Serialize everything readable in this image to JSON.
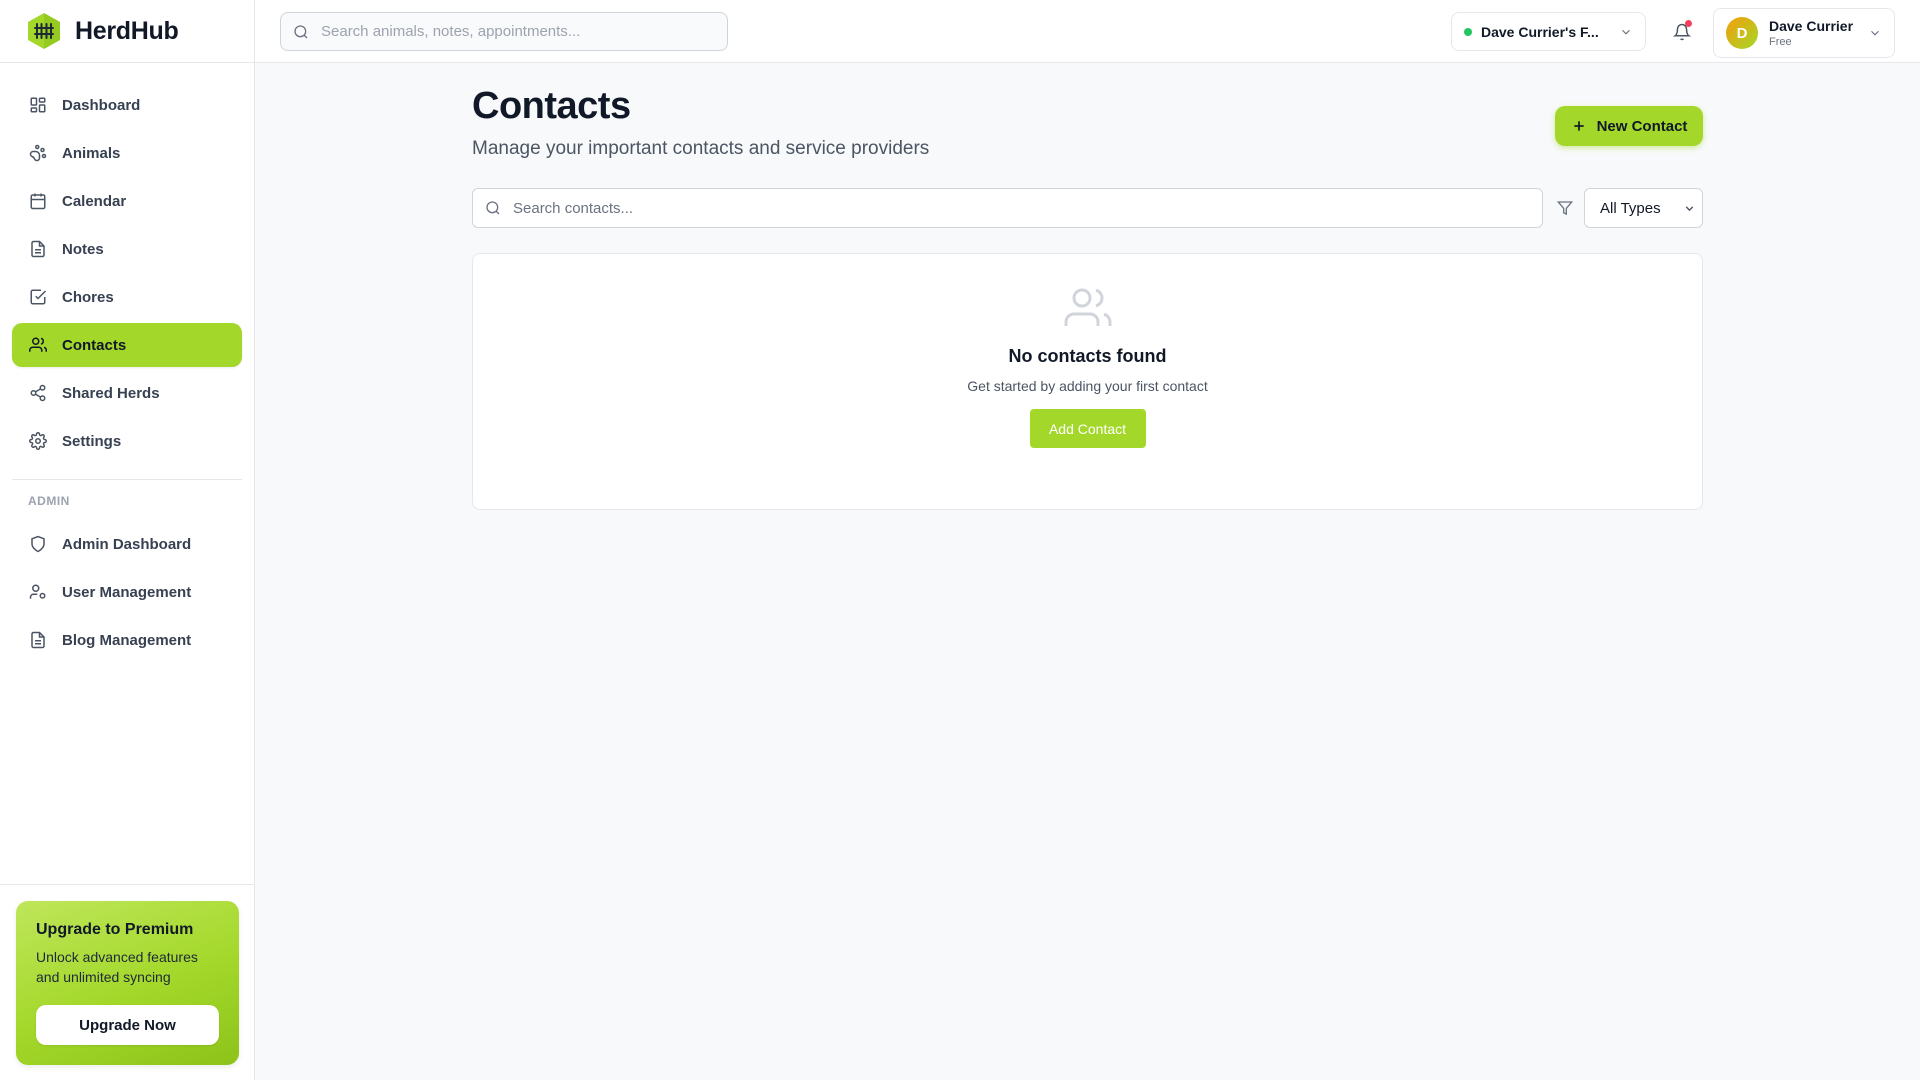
{
  "app": {
    "name": "HerdHub",
    "accent": "#a3d82a"
  },
  "header": {
    "search_placeholder": "Search animals, notes, appointments...",
    "herd_selector": "Dave Currier's F...",
    "user": {
      "name": "Dave Currier",
      "plan": "Free",
      "initial": "D"
    }
  },
  "sidebar": {
    "items": [
      {
        "label": "Dashboard",
        "icon": "dashboard-icon"
      },
      {
        "label": "Animals",
        "icon": "paw-icon"
      },
      {
        "label": "Calendar",
        "icon": "calendar-icon"
      },
      {
        "label": "Notes",
        "icon": "file-text-icon"
      },
      {
        "label": "Chores",
        "icon": "check-square-icon"
      },
      {
        "label": "Contacts",
        "icon": "users-icon",
        "active": true
      },
      {
        "label": "Shared Herds",
        "icon": "share-icon"
      },
      {
        "label": "Settings",
        "icon": "gear-icon"
      }
    ],
    "admin_heading": "ADMIN",
    "admin_items": [
      {
        "label": "Admin Dashboard",
        "icon": "shield-icon"
      },
      {
        "label": "User Management",
        "icon": "user-cog-icon"
      },
      {
        "label": "Blog Management",
        "icon": "file-text-icon"
      }
    ],
    "upgrade": {
      "title": "Upgrade to Premium",
      "description": "Unlock advanced features and unlimited syncing",
      "button": "Upgrade Now"
    }
  },
  "main": {
    "title": "Contacts",
    "subtitle": "Manage your important contacts and service providers",
    "new_contact_button": "New Contact",
    "search_placeholder": "Search contacts...",
    "type_filter": "All Types",
    "empty": {
      "title": "No contacts found",
      "description": "Get started by adding your first contact",
      "button": "Add Contact"
    }
  }
}
